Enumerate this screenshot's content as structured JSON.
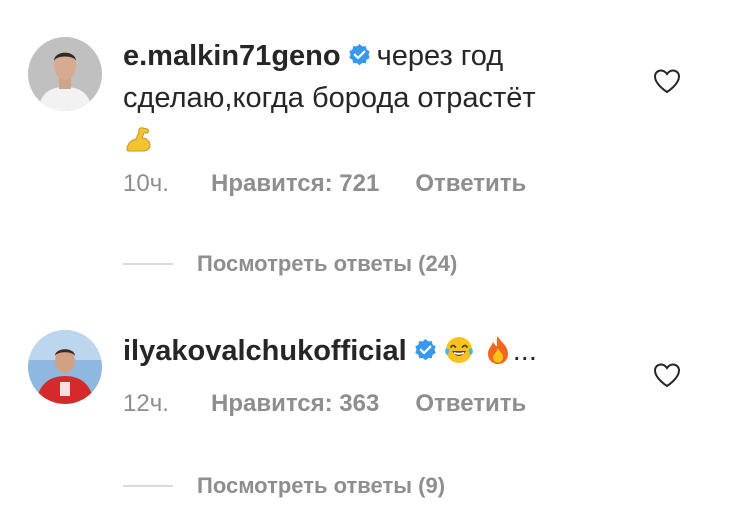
{
  "comments": [
    {
      "username": "e.malkin71geno",
      "text_line1": "через год",
      "text_line2": "сделаю,когда борода отрастёт",
      "emoji": [
        "flexed-biceps"
      ],
      "time": "10ч.",
      "likes": "Нравится: 721",
      "reply": "Ответить",
      "view_replies": "Посмотреть ответы (24)"
    },
    {
      "username": "ilyakovalchukofficial",
      "emoji": [
        "tears-of-joy",
        "fire"
      ],
      "trailing": "...",
      "time": "12ч.",
      "likes": "Нравится: 363",
      "reply": "Ответить",
      "view_replies": "Посмотреть ответы (9)"
    }
  ],
  "icons": {
    "verified": "verified-badge-icon",
    "like": "heart-outline-icon"
  },
  "colors": {
    "verified_blue": "#3897f0",
    "secondary_text": "#8e8e8e",
    "primary_text": "#262626",
    "divider": "#dbdbdb"
  }
}
